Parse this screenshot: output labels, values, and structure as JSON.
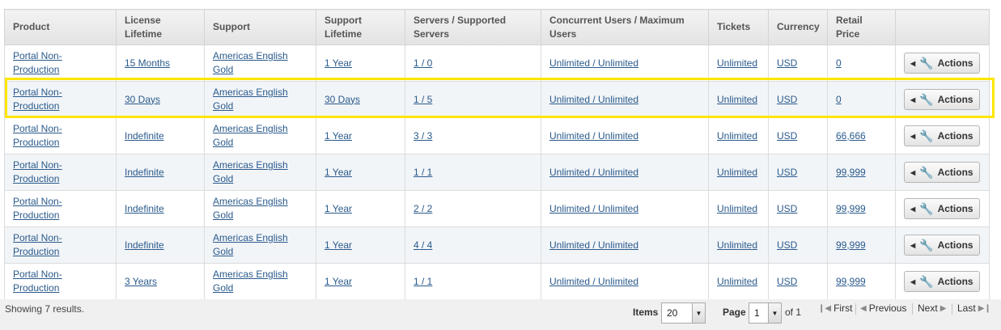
{
  "table": {
    "headers": [
      "Product",
      "License Lifetime",
      "Support",
      "Support Lifetime",
      "Servers / Supported Servers",
      "Concurrent Users / Maximum Users",
      "Tickets",
      "Currency",
      "Retail Price",
      ""
    ],
    "rows": [
      {
        "product": "Portal Non-Production",
        "license_lifetime": "15 Months",
        "support": "Americas English Gold",
        "support_lifetime": "1 Year",
        "servers": "1 / 0",
        "users": "Unlimited / Unlimited",
        "tickets": "Unlimited",
        "currency": "USD",
        "price": "0",
        "action_label": "Actions"
      },
      {
        "product": "Portal Non-Production",
        "license_lifetime": "30 Days",
        "support": "Americas English Gold",
        "support_lifetime": "30 Days",
        "servers": "1 / 5",
        "users": "Unlimited / Unlimited",
        "tickets": "Unlimited",
        "currency": "USD",
        "price": "0",
        "action_label": "Actions"
      },
      {
        "product": "Portal Non-Production",
        "license_lifetime": "Indefinite",
        "support": "Americas English Gold",
        "support_lifetime": "1 Year",
        "servers": "3 / 3",
        "users": "Unlimited / Unlimited",
        "tickets": "Unlimited",
        "currency": "USD",
        "price": "66,666",
        "action_label": "Actions"
      },
      {
        "product": "Portal Non-Production",
        "license_lifetime": "Indefinite",
        "support": "Americas English Gold",
        "support_lifetime": "1 Year",
        "servers": "1 / 1",
        "users": "Unlimited / Unlimited",
        "tickets": "Unlimited",
        "currency": "USD",
        "price": "99,999",
        "action_label": "Actions"
      },
      {
        "product": "Portal Non-Production",
        "license_lifetime": "Indefinite",
        "support": "Americas English Gold",
        "support_lifetime": "1 Year",
        "servers": "2 / 2",
        "users": "Unlimited / Unlimited",
        "tickets": "Unlimited",
        "currency": "USD",
        "price": "99,999",
        "action_label": "Actions"
      },
      {
        "product": "Portal Non-Production",
        "license_lifetime": "Indefinite",
        "support": "Americas English Gold",
        "support_lifetime": "1 Year",
        "servers": "4 / 4",
        "users": "Unlimited / Unlimited",
        "tickets": "Unlimited",
        "currency": "USD",
        "price": "99,999",
        "action_label": "Actions"
      },
      {
        "product": "Portal Non-Production",
        "license_lifetime": "3 Years",
        "support": "Americas English Gold",
        "support_lifetime": "1 Year",
        "servers": "1 / 1",
        "users": "Unlimited / Unlimited",
        "tickets": "Unlimited",
        "currency": "USD",
        "price": "99,999",
        "action_label": "Actions"
      }
    ],
    "highlighted_row": 2
  },
  "footer": {
    "results_text": "Showing 7 results.",
    "items_label": "Items",
    "items_value": "20",
    "page_label": "Page",
    "page_value": "1",
    "page_of": "of 1",
    "first": "First",
    "previous": "Previous",
    "next": "Next",
    "last": "Last"
  },
  "icons": {
    "actions_arrow": "left-triangle-icon",
    "actions_tool": "wrench-icon",
    "dropdown": "chevron-down-icon"
  },
  "colors": {
    "link": "#2a5a8c",
    "highlight": "#ffe600",
    "alt_row": "#f2f5f8"
  }
}
